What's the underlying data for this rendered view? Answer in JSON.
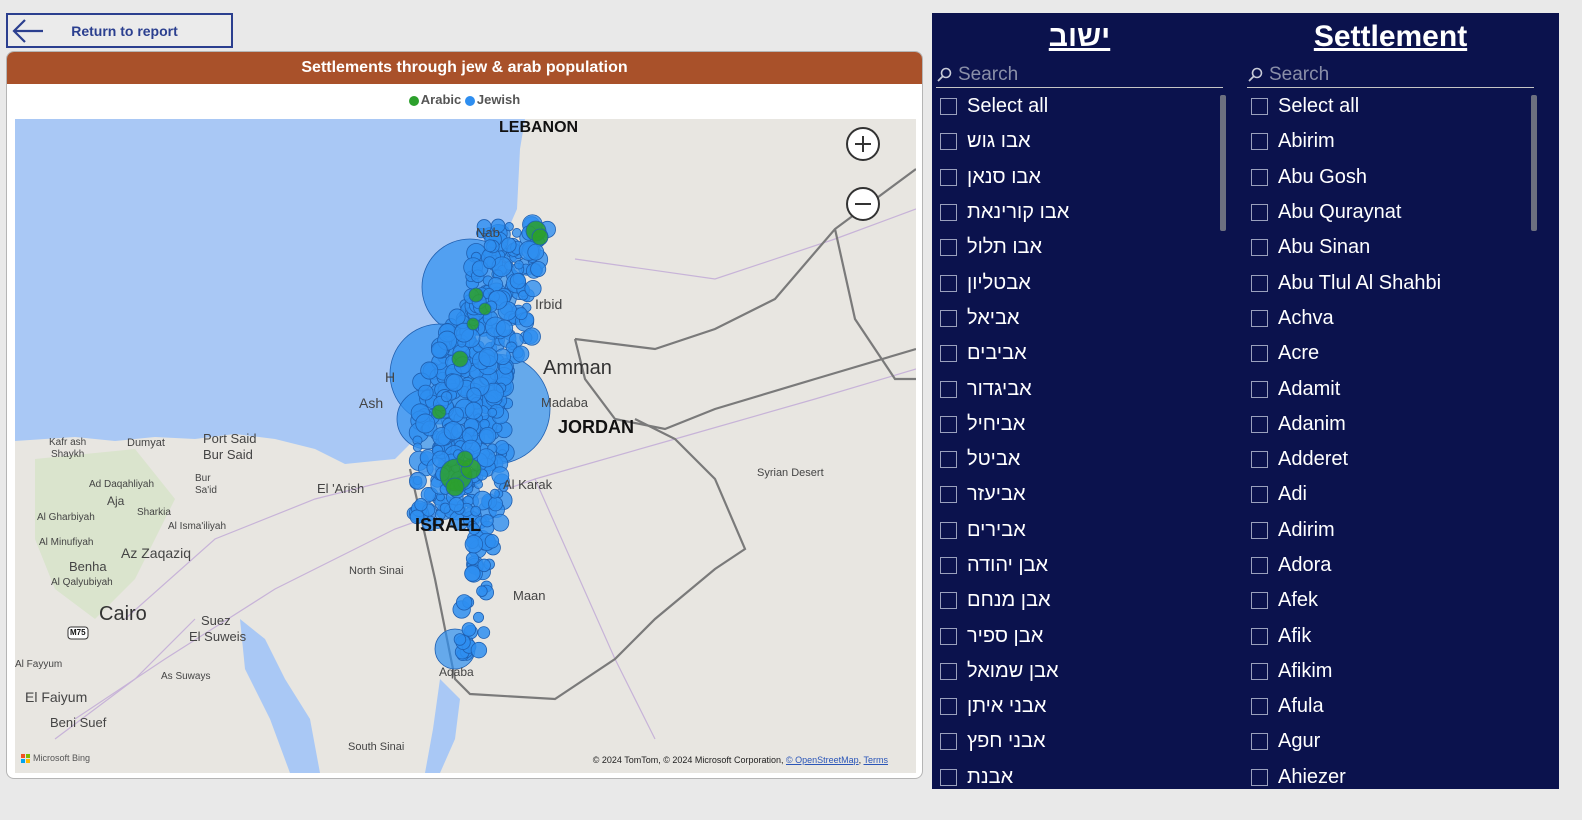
{
  "return_button": {
    "label": "Return to report"
  },
  "map": {
    "title": "Settlements through jew & arab population",
    "legend": [
      {
        "label": "Arabic",
        "color": "#2ca02c"
      },
      {
        "label": "Jewish",
        "color": "#2e8ef0"
      }
    ],
    "places": {
      "lebanon": "LEBANON",
      "jordan": "JORDAN",
      "israel": "ISRAEL",
      "amman": "Amman",
      "madaba": "Madaba",
      "irbid": "Irbid",
      "al_karak": "Al Karak",
      "syrian_desert": "Syrian Desert",
      "maan": "Maan",
      "aqaba": "Aqaba",
      "north_sinai": "North Sinai",
      "south_sinai": "South Sinai",
      "el_arish": "El 'Arish",
      "port_said": "Port Said",
      "bur_said": "Bur Said",
      "dumyat": "Dumyat",
      "kafr_ash_shaykh": "Kafr ash\nShaykh",
      "ad_daqahliyah": "Ad Daqahliyah",
      "aja": "Aja",
      "al_gharbiyah": "Al Gharbiyah",
      "sharkia": "Sharkia",
      "al_ismailiyah": "Al Isma'iliyah",
      "al_minufiyah": "Al Minufiyah",
      "az_zaqaziq": "Az Zaqaziq",
      "benha": "Benha",
      "al_qalyubiyah": "Al Qalyubiyah",
      "cairo": "Cairo",
      "suez": "Suez",
      "el_suweis": "El Suweis",
      "al_fayyum": "Al Fayyum",
      "el_faiyum": "El Faiyum",
      "as_suways": "As Suways",
      "beni_suef": "Beni Suef",
      "bur_said_short": "Bur\nSa'id",
      "ash": "Ash",
      "nab": "Nab",
      "h": "H",
      "m75": "M75"
    },
    "zoom_in": "+",
    "zoom_out": "−",
    "copyright": "© 2024 TomTom, © 2024 Microsoft Corporation,",
    "osm_link": "© OpenStreetMap",
    "terms_link": "Terms",
    "ms_bing": "Microsoft Bing"
  },
  "slicers": {
    "hebrew": {
      "title": "ישוב",
      "search_placeholder": "Search",
      "items": [
        "Select all",
        "אבו גוש",
        "אבו סנאן",
        "אבו קורינאת",
        "אבו תלול",
        "אבטליון",
        "אביאל",
        "אביבים",
        "אביגדור",
        "אביחיל",
        "אביטל",
        "אביעזר",
        "אבירים",
        "אבן יהודה",
        "אבן מנחם",
        "אבן ספיר",
        "אבן שמואל",
        "אבני איתן",
        "אבני חפץ",
        "אבנת"
      ]
    },
    "english": {
      "title": "Settlement",
      "search_placeholder": "Search",
      "items": [
        "Select all",
        "Abirim",
        "Abu Gosh",
        "Abu Quraynat",
        "Abu Sinan",
        "Abu Tlul Al Shahbi",
        "Achva",
        "Acre",
        "Adamit",
        "Adanim",
        "Adderet",
        "Adi",
        "Adirim",
        "Adora",
        "Afek",
        "Afik",
        "Afikim",
        "Afula",
        "Agur",
        "Ahiezer"
      ]
    }
  }
}
